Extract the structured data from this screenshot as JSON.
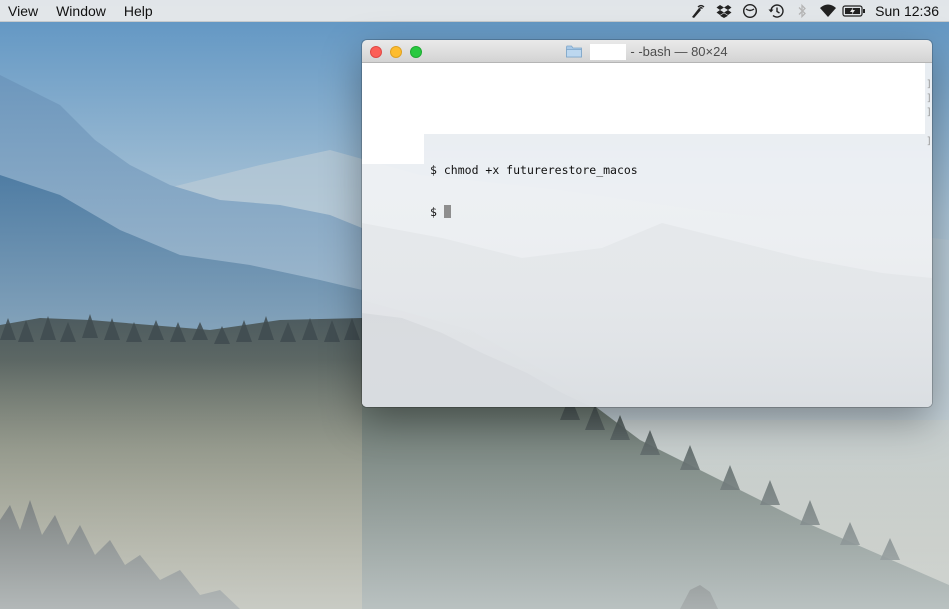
{
  "menubar": {
    "items": [
      "View",
      "Window",
      "Help"
    ],
    "status_icons": [
      "network-activity-icon",
      "dropbox-icon",
      "do-not-disturb-icon",
      "time-machine-icon",
      "bluetooth-icon",
      "wifi-icon",
      "battery-icon"
    ],
    "clock": "Sun 12:36"
  },
  "terminal": {
    "title": "- -bash — 80×24",
    "lines": [
      {
        "prompt": "$",
        "command": "chmod +x futurerestore_macos"
      },
      {
        "prompt": "$",
        "command": ""
      }
    ]
  },
  "colors": {
    "close": "#fc5f57",
    "minimize": "#fdbc2e",
    "zoom": "#28c940"
  }
}
